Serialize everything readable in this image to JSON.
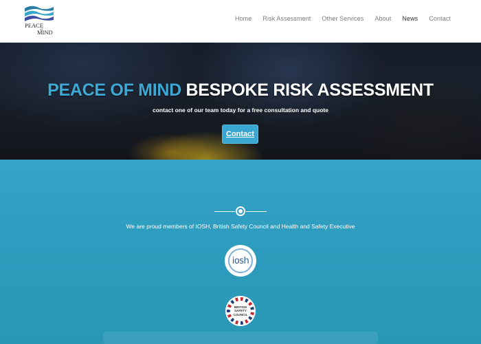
{
  "header": {
    "logo": {
      "line1": "PEACE",
      "of": "of",
      "line2": "MIND"
    },
    "nav": [
      {
        "label": "Home"
      },
      {
        "label": "Risk Assessment"
      },
      {
        "label": "Other Services"
      },
      {
        "label": "About"
      },
      {
        "label": "News"
      },
      {
        "label": "Contact"
      }
    ]
  },
  "hero": {
    "title_accent": "PEACE OF MIND",
    "title_rest": "BESPOKE RISK ASSESSMENT",
    "subtitle": "contact one of our team today for a free consultation and quote",
    "button_label": "Contact"
  },
  "members": {
    "text": "We are proud members of IOSH, British Safety Council and Health and Safety Executive",
    "iosh_label": "iosh",
    "bsc_line1": "BRITISH",
    "bsc_line2": "SAFETY",
    "bsc_line3": "COUNCIL"
  },
  "colors": {
    "accent": "#3fa9d5",
    "section_bg": "#2f9dc0",
    "button": "#3aa6d2"
  }
}
